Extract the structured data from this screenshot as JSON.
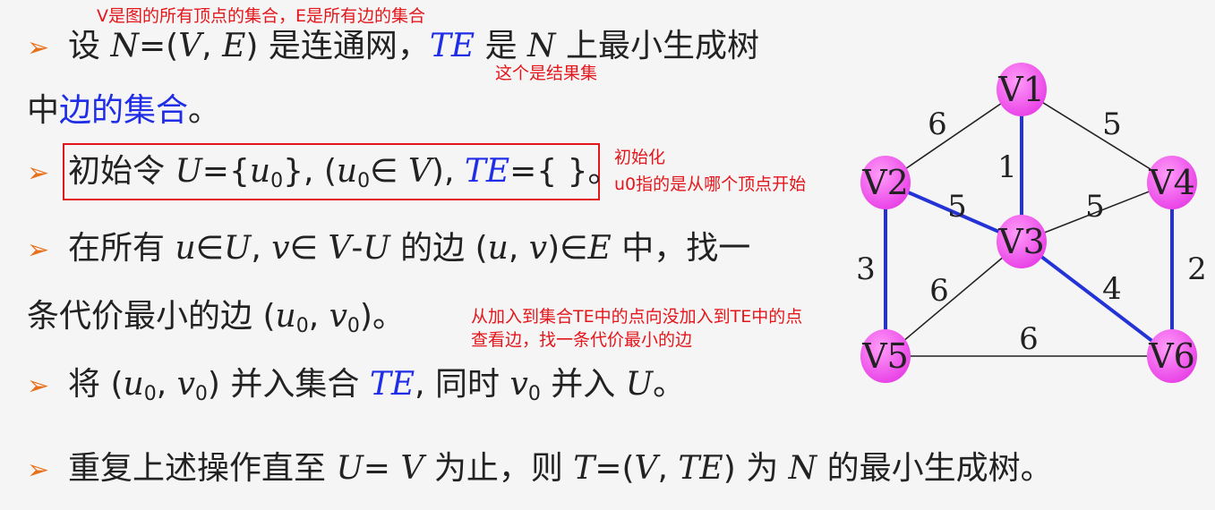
{
  "notes": {
    "top": "V是图的所有顶点的集合，E是所有边的集合",
    "te": "这个是结果集",
    "init_title": "初始化",
    "init_desc": "u0指的是从哪个顶点开始",
    "search": "从加入到集合TE中的点向没加入到TE中的点",
    "search2": "查看边，找一条代价最小的边"
  },
  "line1": {
    "a": "设 ",
    "b": "N",
    "c": "=(",
    "d": "V",
    "e": ", ",
    "f": "E",
    "g": ") 是连通网，",
    "h": "TE",
    "i": " 是 ",
    "j": "N",
    "k": " 上最小生成树"
  },
  "line2": {
    "a": "中",
    "b": "边的集合",
    "c": "。"
  },
  "line3": {
    "a": "初始令 ",
    "b": "U",
    "c": "={",
    "d": "u",
    "d_sub": "0",
    "e": "}, (",
    "f": "u",
    "f_sub": "0",
    "g": "∈ ",
    "h": "V",
    "i": "), ",
    "j": "TE",
    "k": "={ }。"
  },
  "line4": {
    "a": "在所有 ",
    "b": "u",
    "c": "∈",
    "d": "U",
    "e": ", ",
    "f": "v",
    "g": "∈ ",
    "h": "V",
    "i": "-",
    "j": "U",
    "k": " 的边 (",
    "l": "u",
    "m": ", ",
    "n": "v",
    "o": ")∈",
    "p": "E",
    "q": " 中，找一"
  },
  "line5": {
    "a": "条代价最小的边 (",
    "b": "u",
    "b_sub": "0",
    "c": ", ",
    "d": "v",
    "d_sub": "0",
    "e": ")。"
  },
  "line6": {
    "a": "将 (",
    "b": "u",
    "b_sub": "0",
    "c": ", ",
    "d": "v",
    "d_sub": "0",
    "e": ") 并入集合 ",
    "f": "TE",
    "g": ", 同时 ",
    "h": "v",
    "h_sub": "0",
    "i": " 并入 ",
    "j": "U",
    "k": "。"
  },
  "line7": {
    "a": "重复上述操作直至 ",
    "b": "U",
    "c": "= ",
    "d": "V",
    "e": " 为止，则 ",
    "f": "T",
    "g": "=(",
    "h": "V",
    "i": ", ",
    "j": "TE",
    "k": ") 为 ",
    "l": "N",
    "m": " 的最小生成树。"
  },
  "graph": {
    "nodes": [
      "V1",
      "V2",
      "V3",
      "V4",
      "V5",
      "V6"
    ],
    "edges": [
      {
        "from": "V1",
        "to": "V2",
        "weight": "6",
        "mst": false
      },
      {
        "from": "V1",
        "to": "V4",
        "weight": "5",
        "mst": false
      },
      {
        "from": "V1",
        "to": "V3",
        "weight": "1",
        "mst": true
      },
      {
        "from": "V2",
        "to": "V3",
        "weight": "5",
        "mst": true
      },
      {
        "from": "V3",
        "to": "V4",
        "weight": "5",
        "mst": false
      },
      {
        "from": "V2",
        "to": "V5",
        "weight": "3",
        "mst": true
      },
      {
        "from": "V4",
        "to": "V6",
        "weight": "2",
        "mst": true
      },
      {
        "from": "V3",
        "to": "V5",
        "weight": "6",
        "mst": false
      },
      {
        "from": "V3",
        "to": "V6",
        "weight": "4",
        "mst": true
      },
      {
        "from": "V5",
        "to": "V6",
        "weight": "6",
        "mst": false
      }
    ],
    "colors": {
      "node": "#e83de6",
      "mst_edge": "#2433d6",
      "edge": "#222222"
    }
  }
}
